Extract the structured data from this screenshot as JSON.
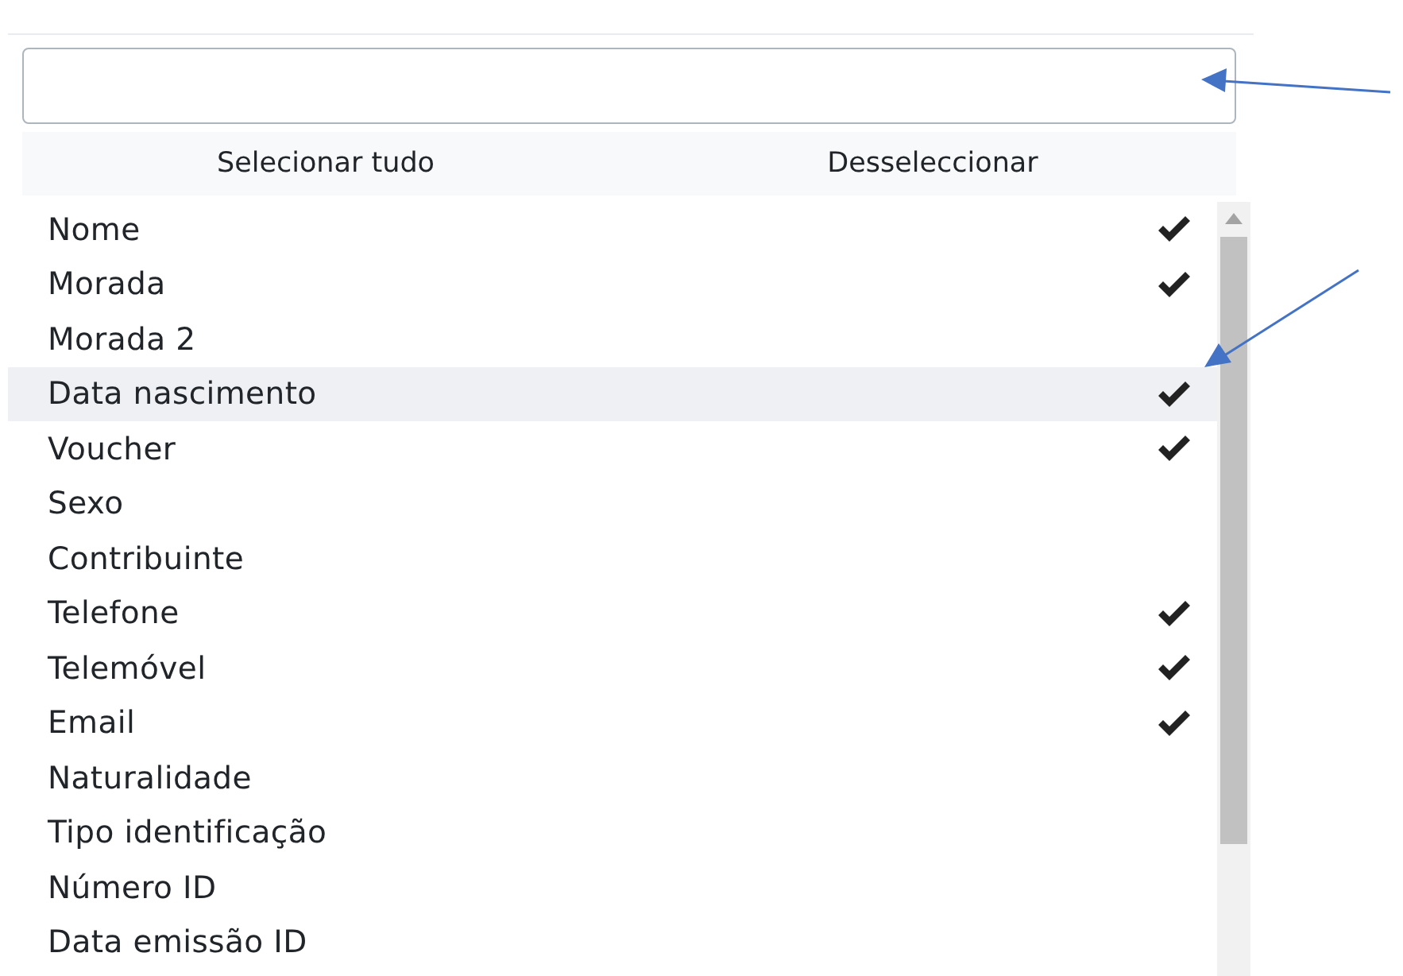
{
  "actions": [
    {
      "label": "Selecionar tudo"
    },
    {
      "label": "Desseleccionar"
    }
  ],
  "items": [
    {
      "label": "Nome",
      "checked": true,
      "hovered": false
    },
    {
      "label": "Morada",
      "checked": true,
      "hovered": false
    },
    {
      "label": "Morada 2",
      "checked": false,
      "hovered": false
    },
    {
      "label": "Data nascimento",
      "checked": true,
      "hovered": true
    },
    {
      "label": "Voucher",
      "checked": true,
      "hovered": false
    },
    {
      "label": "Sexo",
      "checked": false,
      "hovered": false
    },
    {
      "label": "Contribuinte",
      "checked": false,
      "hovered": false
    },
    {
      "label": "Telefone",
      "checked": true,
      "hovered": false
    },
    {
      "label": "Telemóvel",
      "checked": true,
      "hovered": false
    },
    {
      "label": "Email",
      "checked": true,
      "hovered": false
    },
    {
      "label": "Naturalidade",
      "checked": false,
      "hovered": false
    },
    {
      "label": "Tipo identificação",
      "checked": false,
      "hovered": false
    },
    {
      "label": "Número ID",
      "checked": false,
      "hovered": false
    },
    {
      "label": "Data emissão ID",
      "checked": false,
      "hovered": false
    }
  ]
}
